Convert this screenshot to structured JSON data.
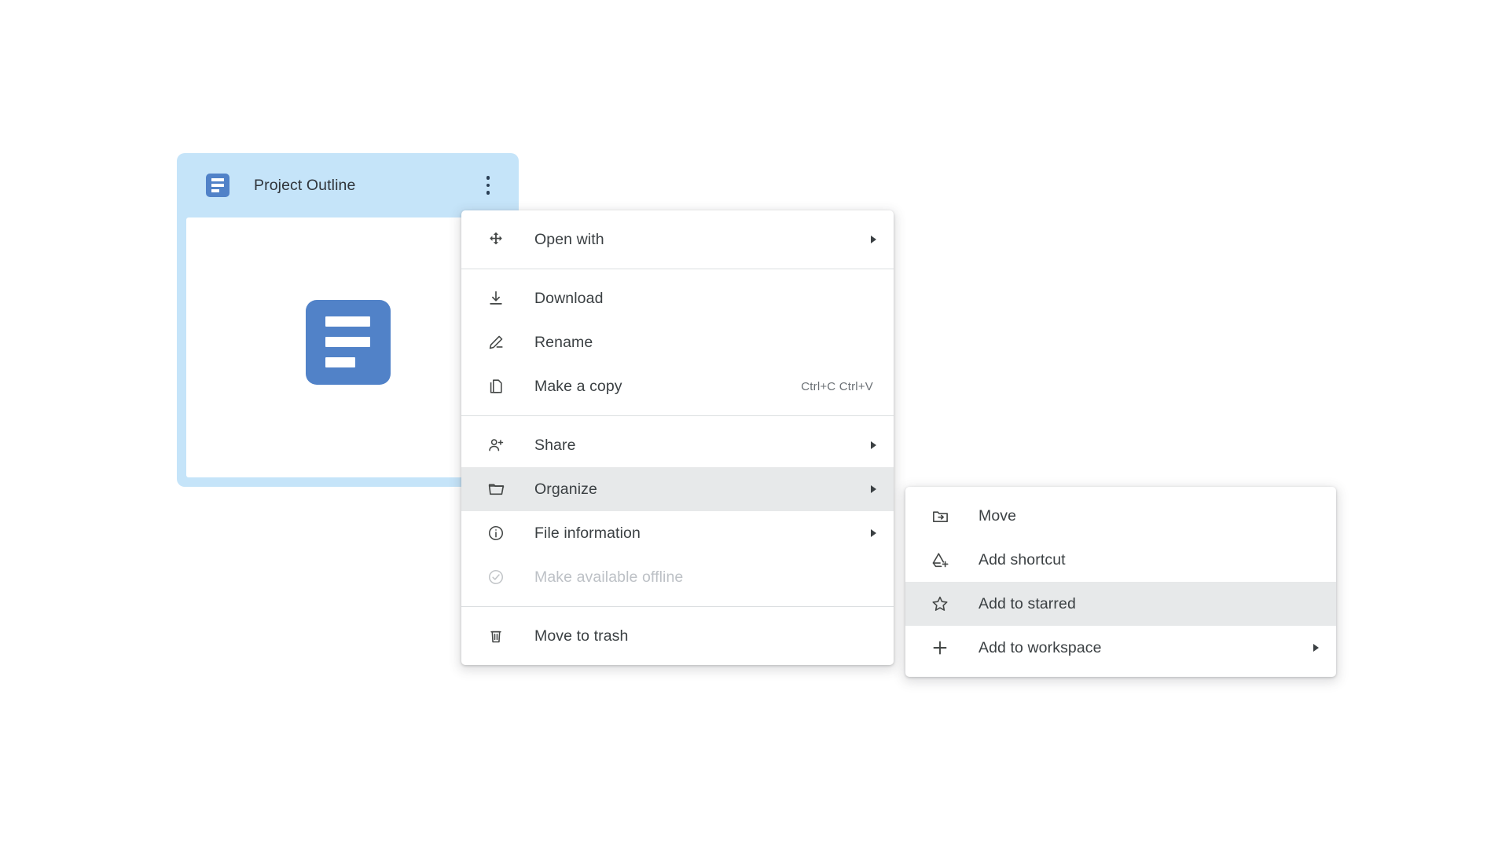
{
  "card": {
    "title": "Project Outline",
    "doc_icon": "google-docs-icon",
    "kebab_icon": "more-vert-icon",
    "selected": true,
    "colors": {
      "selection": "#c5e4f9",
      "doc_blue": "#5182c8",
      "body": "#ffffff"
    }
  },
  "context_menu": {
    "name": "file-context-menu",
    "sections": [
      {
        "items": [
          {
            "label": "Open with",
            "icon": "open-with-icon",
            "submenu": true,
            "shortcut": "",
            "disabled": false,
            "highlighted": false
          }
        ]
      },
      {
        "items": [
          {
            "label": "Download",
            "icon": "download-icon",
            "submenu": false,
            "shortcut": "",
            "disabled": false,
            "highlighted": false
          },
          {
            "label": "Rename",
            "icon": "pencil-icon",
            "submenu": false,
            "shortcut": "",
            "disabled": false,
            "highlighted": false
          },
          {
            "label": "Make a copy",
            "icon": "copy-icon",
            "submenu": false,
            "shortcut": "Ctrl+C Ctrl+V",
            "disabled": false,
            "highlighted": false
          }
        ]
      },
      {
        "items": [
          {
            "label": "Share",
            "icon": "person-add-icon",
            "submenu": true,
            "shortcut": "",
            "disabled": false,
            "highlighted": false
          },
          {
            "label": "Organize",
            "icon": "folder-icon",
            "submenu": true,
            "shortcut": "",
            "disabled": false,
            "highlighted": true
          },
          {
            "label": "File information",
            "icon": "info-circle-icon",
            "submenu": true,
            "shortcut": "",
            "disabled": false,
            "highlighted": false
          },
          {
            "label": "Make available offline",
            "icon": "offline-check-icon",
            "submenu": false,
            "shortcut": "",
            "disabled": true,
            "highlighted": false
          }
        ]
      },
      {
        "items": [
          {
            "label": "Move to trash",
            "icon": "trash-icon",
            "submenu": false,
            "shortcut": "",
            "disabled": false,
            "highlighted": false
          }
        ]
      }
    ]
  },
  "organize_submenu": {
    "name": "organize-submenu",
    "items": [
      {
        "label": "Move",
        "icon": "folder-move-icon",
        "submenu": false,
        "disabled": false,
        "highlighted": false
      },
      {
        "label": "Add shortcut",
        "icon": "add-shortcut-icon",
        "submenu": false,
        "disabled": false,
        "highlighted": false
      },
      {
        "label": "Add to starred",
        "icon": "star-outline-icon",
        "submenu": false,
        "disabled": false,
        "highlighted": true
      },
      {
        "label": "Add to workspace",
        "icon": "plus-icon",
        "submenu": true,
        "disabled": false,
        "highlighted": false
      }
    ]
  }
}
